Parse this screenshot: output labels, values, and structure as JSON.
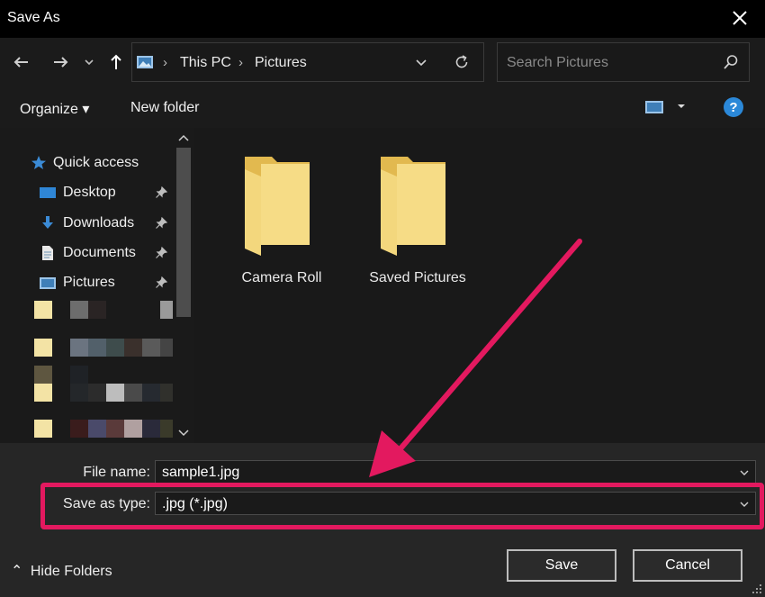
{
  "window": {
    "title": "Save As"
  },
  "address": {
    "crumbs": [
      "This PC",
      "Pictures"
    ]
  },
  "search": {
    "placeholder": "Search Pictures"
  },
  "toolbar": {
    "organize": "Organize",
    "new_folder": "New folder"
  },
  "nav": {
    "quick_access": "Quick access",
    "items": [
      {
        "label": "Desktop",
        "icon": "desktop-icon"
      },
      {
        "label": "Downloads",
        "icon": "downloads-icon"
      },
      {
        "label": "Documents",
        "icon": "documents-icon"
      },
      {
        "label": "Pictures",
        "icon": "pictures-icon"
      }
    ]
  },
  "folders": [
    {
      "label": "Camera Roll"
    },
    {
      "label": "Saved Pictures"
    }
  ],
  "form": {
    "file_name_label": "File name:",
    "file_name_value": "sample1.jpg",
    "save_type_label": "Save as type:",
    "save_type_value": ".jpg (*.jpg)"
  },
  "buttons": {
    "save": "Save",
    "cancel": "Cancel",
    "hide_folders": "Hide Folders"
  },
  "colors": {
    "highlight": "#e3195f",
    "folder": "#f3d77d",
    "accent": "#3b8bd6"
  }
}
